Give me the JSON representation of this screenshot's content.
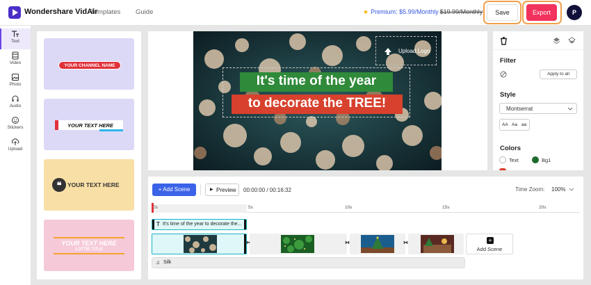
{
  "header": {
    "brand": "Wondershare VidAir",
    "nav": [
      "Templates",
      "Guide"
    ],
    "premium_label": "Premium: $5.99/Monthly",
    "premium_old_price": "$19.99/Monthly",
    "save_label": "Save",
    "export_label": "Export",
    "avatar_initial": "P"
  },
  "sidebar": {
    "items": [
      {
        "label": "Text",
        "icon": "text-icon"
      },
      {
        "label": "Video",
        "icon": "video-icon"
      },
      {
        "label": "Photo",
        "icon": "photo-icon"
      },
      {
        "label": "Audio",
        "icon": "headphones-icon"
      },
      {
        "label": "Stickers",
        "icon": "smiley-icon"
      },
      {
        "label": "Upload",
        "icon": "upload-icon"
      }
    ]
  },
  "templates": [
    {
      "text": "YOUR CHANNEL NAME",
      "bg": "#dcd9f7"
    },
    {
      "text": "YOUR TEXT HERE",
      "bg": "#dcd9f7"
    },
    {
      "text": "YOUR TEXT HERE",
      "bg": "#f8dfa5"
    },
    {
      "text": "YOUR TEXT HERE",
      "sub": "LOTTIE TITLE",
      "bg": "#f6c9d8"
    }
  ],
  "preview": {
    "line1": "It's time of the year",
    "line2": "to decorate the TREE!",
    "upload_logo": "Upload Logo",
    "line1_bg": "#2f8a3a",
    "line2_bg": "#d7412d"
  },
  "right_panel": {
    "filter_title": "Filter",
    "apply_all": "Apply to all",
    "style_title": "Style",
    "font_value": "Montserrat",
    "case_options": [
      "AA",
      "Aa",
      "aa"
    ],
    "colors_title": "Colors",
    "color_text": "Text",
    "color_bg": "Bg1"
  },
  "timeline": {
    "add_scene": "+ Add Scene",
    "preview_label": "Preview",
    "time": "00:00:00 / 00:16:32",
    "zoom_label": "Time Zoom:",
    "zoom_value": "100%",
    "ticks": [
      "0s",
      "5s",
      "10s",
      "15s",
      "20s"
    ],
    "text_clip": "It's time of the year to decorate the...",
    "add_scene_tile": "Add Scene",
    "audio_clip": "Silk"
  }
}
